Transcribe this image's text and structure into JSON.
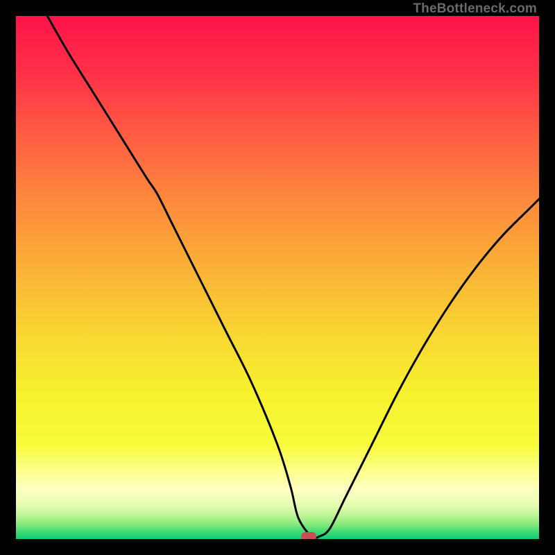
{
  "attribution": "TheBottleneck.com",
  "gradient_stops": [
    {
      "offset": 0.0,
      "color": "#ff1449"
    },
    {
      "offset": 0.1,
      "color": "#ff2d48"
    },
    {
      "offset": 0.22,
      "color": "#fe5a43"
    },
    {
      "offset": 0.35,
      "color": "#fd883d"
    },
    {
      "offset": 0.48,
      "color": "#fbb037"
    },
    {
      "offset": 0.6,
      "color": "#f9d432"
    },
    {
      "offset": 0.72,
      "color": "#f7f12e"
    },
    {
      "offset": 0.82,
      "color": "#f7fb3a"
    },
    {
      "offset": 0.86,
      "color": "#fbfe7c"
    },
    {
      "offset": 0.905,
      "color": "#feffc3"
    },
    {
      "offset": 0.935,
      "color": "#e6fcb2"
    },
    {
      "offset": 0.955,
      "color": "#bdf595"
    },
    {
      "offset": 0.972,
      "color": "#85ea7c"
    },
    {
      "offset": 0.985,
      "color": "#45db74"
    },
    {
      "offset": 1.0,
      "color": "#0fce78"
    }
  ],
  "chart_data": {
    "type": "line",
    "title": "",
    "xlabel": "",
    "ylabel": "",
    "xlim": [
      0,
      100
    ],
    "ylim": [
      0,
      100
    ],
    "grid": false,
    "series": [
      {
        "name": "bottleneck-curve",
        "x": [
          6,
          10,
          15,
          20,
          25,
          27,
          30,
          35,
          40,
          45,
          50,
          52.5,
          54,
          56.5,
          58,
          60,
          63,
          68,
          73,
          78,
          83,
          88,
          93,
          98,
          100
        ],
        "y": [
          100,
          93,
          85,
          77,
          69,
          66,
          60,
          50,
          40,
          30,
          18,
          10,
          4,
          0.5,
          0.5,
          2,
          8,
          18,
          28,
          37,
          45,
          52,
          58,
          63,
          65
        ]
      }
    ],
    "marker": {
      "x": 56,
      "y": 0.5,
      "w": 3.0,
      "h": 1.7
    }
  }
}
